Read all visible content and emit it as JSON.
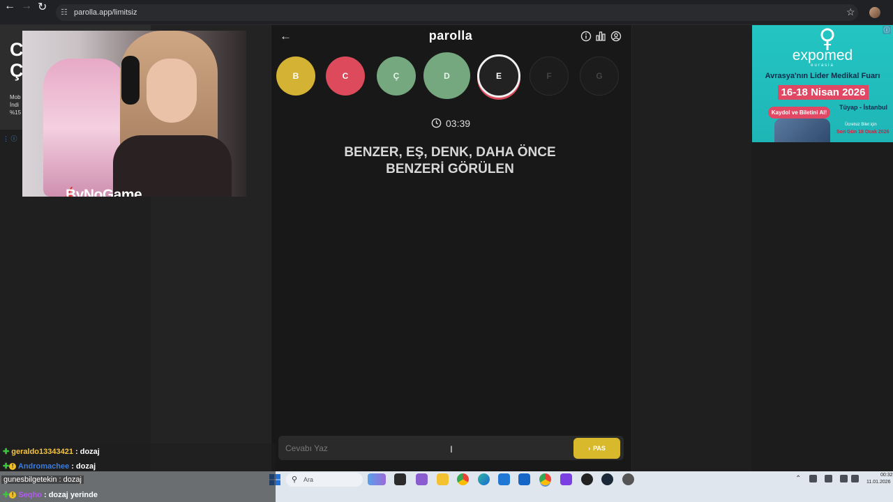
{
  "browser": {
    "url": "parolla.app/limitsiz"
  },
  "left_card": {
    "title": "CÇ",
    "small": "Mob İndi %15"
  },
  "webcam": {
    "brand": "ByNoGame"
  },
  "app": {
    "title": "parolla",
    "letters": [
      "B",
      "C",
      "Ç",
      "D",
      "E",
      "F",
      "G"
    ],
    "current_letter": "E",
    "timer": "03:39",
    "question": "BENZER, EŞ, DENK, DAHA ÖNCE BENZERİ GÖRÜLEN",
    "answer_placeholder": "Cevabı Yaz",
    "pass_label": "PAS",
    "colors": {
      "yellow": "#d4b233",
      "red": "#dc4a5c",
      "green": "#75a87e"
    }
  },
  "ad": {
    "brand": "expomed",
    "brand_sub": "eurasia",
    "tagline": "Avrasya'nın Lider Medikal Fuarı",
    "dates": "16-18 Nisan 2026",
    "register": "Kaydol ve Biletini Al!",
    "venue": "Tüyap - İstanbul",
    "free_ticket": "Ücretsiz Bilet için",
    "deadline": "Son Gün 18 Ocak 2026"
  },
  "chat": [
    {
      "user": "geraldo13343421",
      "message": "dozaj"
    },
    {
      "user": "Andromachee",
      "message": "dozaj"
    },
    {
      "user": "gunesbilgetekin",
      "message": "dozaj"
    },
    {
      "user": "Seqho",
      "message": "dozaj yerinde"
    }
  ],
  "taskbar": {
    "search_placeholder": "Ara",
    "time": "00:32",
    "date": "11.01.2026"
  }
}
